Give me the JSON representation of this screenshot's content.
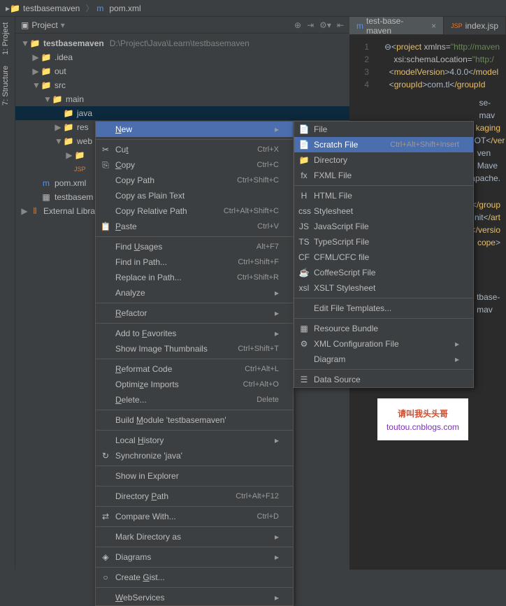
{
  "breadcrumb": {
    "project": "testbasemaven",
    "file": "pom.xml"
  },
  "sideTabs": {
    "project": "1: Project",
    "structure": "7: Structure"
  },
  "panel": {
    "title": "Project"
  },
  "tree": {
    "root": "testbasemaven",
    "rootPath": "D:\\Project\\Java\\Learn\\testbasemaven",
    "idea": ".idea",
    "out": "out",
    "src": "src",
    "main": "main",
    "java": "java",
    "res": "res",
    "web": "web",
    "pom": "pom.xml",
    "iml": "testbasem",
    "ext": "External Librar"
  },
  "editorTabs": {
    "active": "test-base-maven",
    "other": "index.jsp"
  },
  "code": {
    "l1": "project",
    "l1attr": "xmlns",
    "l1val": "\"http://maven",
    "l2a": "xsi",
    "l2b": "schemaLocation",
    "l2c": "\"http:/",
    "l3a": "modelVersion",
    "l3b": "4.0.0",
    "l3c": "/model",
    "l4a": "groupId",
    "l4b": "com.tl",
    "l4c": "/groupId",
    "s1": "se-mav",
    "s2": "kaging",
    "s3": "HOT",
    "s3b": "/ver",
    "s4": "ven Mave",
    "s5": "apache.",
    "e1": "/group",
    "e2": "nit",
    "e2b": "/art",
    "e3": "/versio",
    "e4": "cope",
    "e5": "tbase-mav"
  },
  "menu1": [
    {
      "label": "New",
      "arrow": true,
      "hl": true,
      "u": "N"
    },
    {
      "sep": true
    },
    {
      "label": "Cut",
      "shortcut": "Ctrl+X",
      "icon": "✂",
      "u": "t"
    },
    {
      "label": "Copy",
      "shortcut": "Ctrl+C",
      "icon": "⎘",
      "u": "C"
    },
    {
      "label": "Copy Path",
      "shortcut": "Ctrl+Shift+C"
    },
    {
      "label": "Copy as Plain Text"
    },
    {
      "label": "Copy Relative Path",
      "shortcut": "Ctrl+Alt+Shift+C"
    },
    {
      "label": "Paste",
      "shortcut": "Ctrl+V",
      "icon": "📋",
      "u": "P"
    },
    {
      "sep": true
    },
    {
      "label": "Find Usages",
      "shortcut": "Alt+F7",
      "u": "U"
    },
    {
      "label": "Find in Path...",
      "shortcut": "Ctrl+Shift+F"
    },
    {
      "label": "Replace in Path...",
      "shortcut": "Ctrl+Shift+R"
    },
    {
      "label": "Analyze",
      "arrow": true
    },
    {
      "sep": true
    },
    {
      "label": "Refactor",
      "arrow": true,
      "u": "R"
    },
    {
      "sep": true
    },
    {
      "label": "Add to Favorites",
      "arrow": true,
      "u": "F"
    },
    {
      "label": "Show Image Thumbnails",
      "shortcut": "Ctrl+Shift+T"
    },
    {
      "sep": true
    },
    {
      "label": "Reformat Code",
      "shortcut": "Ctrl+Alt+L",
      "u": "R"
    },
    {
      "label": "Optimize Imports",
      "shortcut": "Ctrl+Alt+O",
      "u": "z"
    },
    {
      "label": "Delete...",
      "shortcut": "Delete",
      "u": "D"
    },
    {
      "sep": true
    },
    {
      "label": "Build Module 'testbasemaven'",
      "u": "M"
    },
    {
      "sep": true
    },
    {
      "label": "Local History",
      "arrow": true,
      "u": "H"
    },
    {
      "label": "Synchronize 'java'",
      "icon": "↻"
    },
    {
      "sep": true
    },
    {
      "label": "Show in Explorer"
    },
    {
      "sep": true
    },
    {
      "label": "Directory Path",
      "shortcut": "Ctrl+Alt+F12",
      "u": "P"
    },
    {
      "sep": true
    },
    {
      "label": "Compare With...",
      "shortcut": "Ctrl+D",
      "icon": "⇄"
    },
    {
      "sep": true
    },
    {
      "label": "Mark Directory as",
      "arrow": true
    },
    {
      "sep": true
    },
    {
      "label": "Diagrams",
      "arrow": true,
      "icon": "◈"
    },
    {
      "sep": true
    },
    {
      "label": "Create Gist...",
      "icon": "○",
      "u": "G"
    },
    {
      "sep": true
    },
    {
      "label": "WebServices",
      "arrow": true,
      "u": "W"
    }
  ],
  "menu2": [
    {
      "label": "File",
      "icon": "📄"
    },
    {
      "label": "Scratch File",
      "shortcut": "Ctrl+Alt+Shift+Insert",
      "icon": "📄",
      "hl": true
    },
    {
      "label": "Directory",
      "icon": "📁"
    },
    {
      "label": "FXML File",
      "icon": "fx"
    },
    {
      "sep": true
    },
    {
      "label": "HTML File",
      "icon": "H"
    },
    {
      "label": "Stylesheet",
      "icon": "css"
    },
    {
      "label": "JavaScript File",
      "icon": "JS"
    },
    {
      "label": "TypeScript File",
      "icon": "TS"
    },
    {
      "label": "CFML/CFC file",
      "icon": "CF"
    },
    {
      "label": "CoffeeScript File",
      "icon": "☕"
    },
    {
      "label": "XSLT Stylesheet",
      "icon": "xsl"
    },
    {
      "sep": true
    },
    {
      "label": "Edit File Templates..."
    },
    {
      "sep": true
    },
    {
      "label": "Resource Bundle",
      "icon": "▦"
    },
    {
      "label": "XML Configuration File",
      "arrow": true,
      "icon": "⚙"
    },
    {
      "label": "Diagram",
      "arrow": true
    },
    {
      "sep": true
    },
    {
      "label": "Data Source",
      "icon": "☰"
    }
  ],
  "watermark": {
    "text": "请叫我头头哥",
    "url": "toutou.cnblogs.com"
  }
}
